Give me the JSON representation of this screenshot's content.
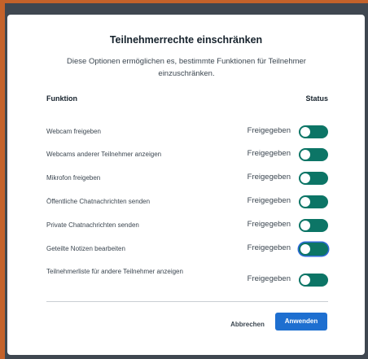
{
  "modal": {
    "title": "Teilnehmerrechte einschränken",
    "description": "Diese Optionen ermöglichen es, bestimmte Funktionen für Teilnehmer einzuschränken.",
    "columns": {
      "function": "Funktion",
      "status": "Status"
    },
    "rows": [
      {
        "label": "Webcam freigeben",
        "status": "Freigegeben",
        "enabled": true
      },
      {
        "label": "Webcams anderer Teilnehmer anzeigen",
        "status": "Freigegeben",
        "enabled": true
      },
      {
        "label": "Mikrofon freigeben",
        "status": "Freigegeben",
        "enabled": true
      },
      {
        "label": "Öffentliche Chatnachrichten senden",
        "status": "Freigegeben",
        "enabled": true
      },
      {
        "label": "Private Chatnachrichten senden",
        "status": "Freigegeben",
        "enabled": true
      },
      {
        "label": "Geteilte Notizen bearbeiten",
        "status": "Freigegeben",
        "enabled": true
      },
      {
        "label": "Teilnehmerliste für andere Teilnehmer anzeigen",
        "status": "Freigegeben",
        "enabled": true
      }
    ],
    "buttons": {
      "cancel": "Abbrechen",
      "apply": "Anwenden"
    }
  },
  "colors": {
    "background": "#c4622a",
    "backdrop": "#3f4750",
    "toggle_on": "#0c7566",
    "primary_button": "#1e6fd0"
  }
}
